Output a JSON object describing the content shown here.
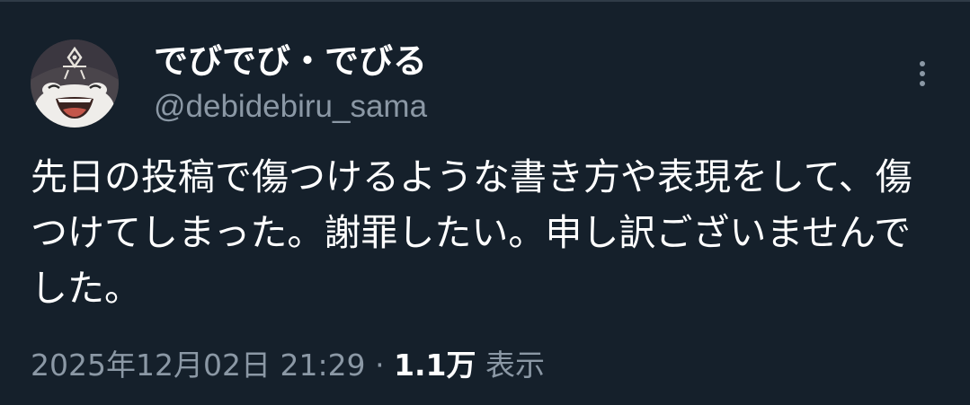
{
  "tweet": {
    "author": {
      "display_name": "でびでび・でびる",
      "handle": "@debidebiru_sama"
    },
    "more_icon": "more-vertical-icon",
    "text": "先日の投稿で傷つけるような書き方や表現をして、傷つけてしまった。謝罪したい。申し訳ございませんでした。",
    "timestamp": "2025年12月02日 21:29",
    "separator": "·",
    "views_count": "1.1万",
    "views_label": "表示"
  },
  "colors": {
    "background": "#15202b",
    "primary_text": "#ffffff",
    "secondary_text": "#8b98a5"
  }
}
